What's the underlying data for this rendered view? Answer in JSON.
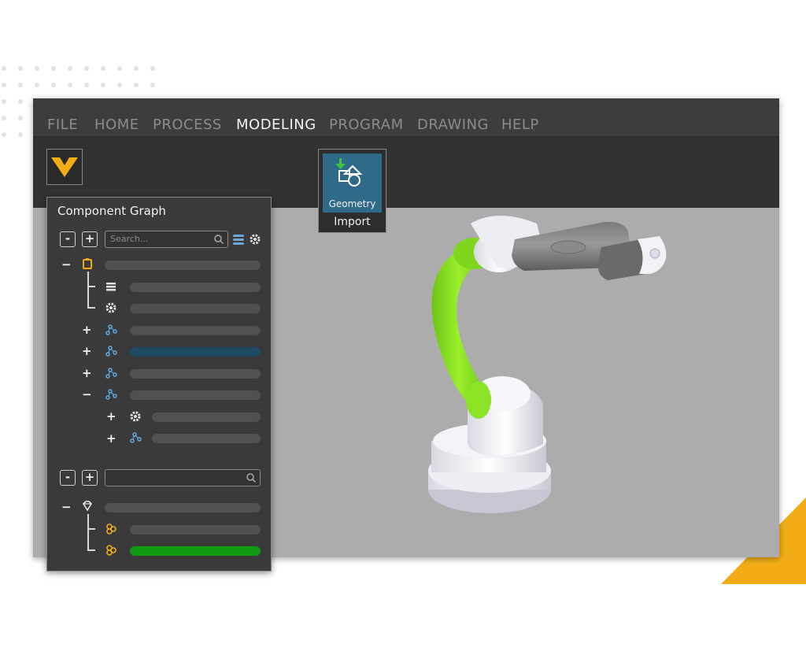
{
  "menu": [
    "FILE",
    "HOME",
    "PROCESS",
    "MODELING",
    "PROGRAM",
    "DRAWING",
    "HELP"
  ],
  "active_menu": "MODELING",
  "ribbon": {
    "geometry_label": "Geometry",
    "group_label": "Import"
  },
  "component_graph": {
    "title": "Component Graph",
    "search_placeholder": "Search...",
    "collapse_label": "-",
    "expand_label": "+"
  },
  "colors": {
    "accent_triangle": "#f2ad16",
    "selection": "#1f4a63",
    "highlight_green": "#0e9a12",
    "robot_green": "#88e01f"
  },
  "icons": {
    "logo": "visual-components-logo",
    "search": "search-icon",
    "settings": "gear-icon",
    "tree_node": "node-tree-icon"
  }
}
